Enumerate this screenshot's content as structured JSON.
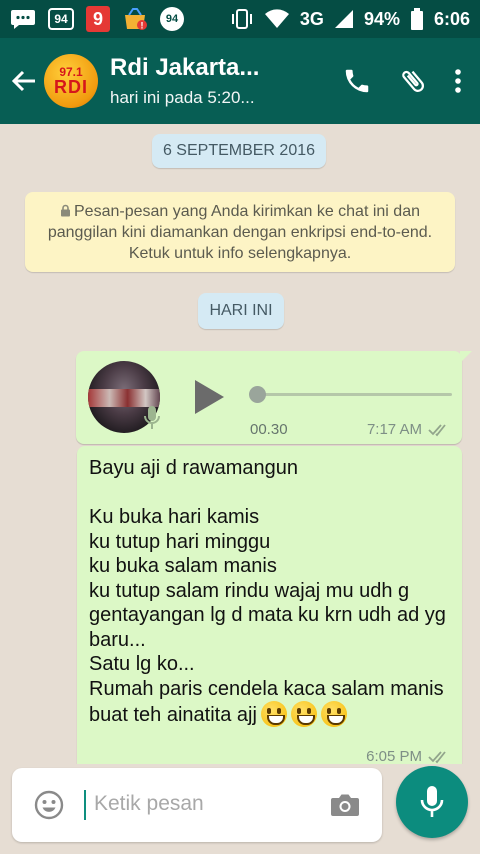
{
  "status_bar": {
    "badge_left": "94",
    "red_badge": "9",
    "circle_badge": "94",
    "network": "3G",
    "battery": "94%",
    "time": "6:06"
  },
  "header": {
    "avatar_freq": "97.1",
    "avatar_brand": "RDI",
    "title": "Rdi Jakarta...",
    "subtitle": "hari ini pada 5:20..."
  },
  "chat": {
    "date_chip": "6 SEPTEMBER 2016",
    "encryption_notice": "Pesan-pesan yang Anda kirimkan ke chat ini dan panggilan kini diamankan dengan enkripsi end-to-end. Ketuk untuk info selengkapnya.",
    "today_chip": "HARI INI",
    "voice_message": {
      "duration": "00.30",
      "time": "7:17 AM",
      "progress": 0
    },
    "text_message": {
      "text": "Bayu aji d rawamangun\n\nKu buka hari kamis\nku tutup hari minggu\nku buka salam manis\nku tutup salam rindu wajaj mu udh g gentayangan lg d mata ku krn udh ad yg baru...\nSatu lg ko...\nRumah paris cendela kaca salam manis buat teh ainatita ajj",
      "emoji_count": 3,
      "time": "6:05 PM"
    }
  },
  "input": {
    "placeholder": "Ketik pesan"
  },
  "colors": {
    "header": "#075e54",
    "status_bar": "#054d44",
    "outgoing_bubble": "#dcf8c6",
    "notice": "#fdf4c5",
    "date_chip": "#d5eaf4",
    "fab": "#0c8c7e"
  },
  "icons": [
    "back-arrow-icon",
    "phone-icon",
    "paperclip-icon",
    "more-vert-icon",
    "lock-icon",
    "play-icon",
    "mic-icon",
    "double-check-icon",
    "emoji-icon",
    "camera-icon"
  ]
}
